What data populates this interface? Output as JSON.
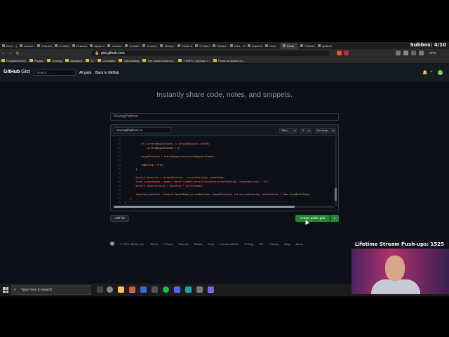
{
  "stream": {
    "subs_label": "Subbos: 4/10",
    "cam_title": "Lifetime Stream Push-ups: 1525"
  },
  "browser": {
    "tabs": [
      {
        "label": "Move - y"
      },
      {
        "label": "Launch H"
      },
      {
        "label": "Characte"
      },
      {
        "label": "Youtube"
      },
      {
        "label": "Finished"
      },
      {
        "label": "Space G"
      },
      {
        "label": "Youtube"
      },
      {
        "label": "Youtube"
      },
      {
        "label": "Youtube"
      },
      {
        "label": "Tomary C"
      },
      {
        "label": "Prinoh A"
      },
      {
        "label": "I'll How t"
      },
      {
        "label": "Surface C"
      },
      {
        "label": "Dani - Yo"
      },
      {
        "label": "Superbut"
      },
      {
        "label": "Store"
      },
      {
        "label": "Creat",
        "active": true
      },
      {
        "label": "Portfolio"
      },
      {
        "label": "spatiotii"
      }
    ],
    "url": "gist.github.com",
    "vpn_label": "VPN",
    "bookmarks": [
      {
        "label": "Programmering"
      },
      {
        "label": "Physics"
      },
      {
        "label": "Gaming"
      },
      {
        "label": "Blackjack"
      },
      {
        "label": "TV"
      },
      {
        "label": "Unrealfilm"
      },
      {
        "label": "Videoediting"
      },
      {
        "label": "The install content s..."
      },
      {
        "label": "YTMP3 | YouTube t..."
      },
      {
        "label": "Phind: AI search en..."
      }
    ]
  },
  "github": {
    "logo": "GitHub",
    "logo_suffix": "Gist",
    "search_placeholder": "Search...",
    "nav": {
      "all_gists": "All gists",
      "back": "Back to GitHub"
    },
    "tagline": "Instantly share code, notes, and snippets.",
    "description_value": "MovingPlatform",
    "filename_value": "MovingPlatform.cs",
    "indent_mode": "Tabs",
    "indent_size": "2",
    "wrap_mode": "No wrap",
    "code_lines": [
      {
        "n": "38",
        "t": ""
      },
      {
        "n": "39",
        "t": "            if (currentWaypointIndex >= actualWaypoints.Length)"
      },
      {
        "n": "40",
        "t": "                currentWaypointIndex = 0;"
      },
      {
        "n": "41",
        "t": ""
      },
      {
        "n": "42",
        "t": "            targetPosition = actualWaypoints[currentWaypointIndex];"
      },
      {
        "n": "43",
        "t": ""
      },
      {
        "n": "44",
        "t": "            isWaiting = true;"
      },
      {
        "n": "45",
        "t": "        }"
      },
      {
        "n": "46",
        "t": ""
      },
      {
        "n": "47",
        "t": "        Vector3 direction = (targetPosition - currentPosition).normalized;"
      },
      {
        "n": "48",
        "t": "        float currentSpeed = speed * Mathf.Clamp01(Vector3.Distance(currentPosition, targetPosition) / 1f);"
      },
      {
        "n": "49",
        "t": "        Vector3 targetVelocity = direction * currentSpeed;"
      },
      {
        "n": "50",
        "t": ""
      },
      {
        "n": "51",
        "t": "        transform.position = Vector3.SmoothDamp(currentPosition, targetPosition, ref currentVelocity, acceleration * Time.fixedDeltaTime);"
      },
      {
        "n": "52",
        "t": "    }"
      },
      {
        "n": "53",
        "t": "}"
      }
    ],
    "add_file": "Add file",
    "create_button": "Create public gist",
    "create_dropdown": "▾",
    "footer": {
      "copyright": "© 2023 GitHub, Inc.",
      "links": [
        "Terms",
        "Privacy",
        "Security",
        "Status",
        "Docs",
        "Contact GitHub",
        "Pricing",
        "API",
        "Training",
        "Blog",
        "About"
      ]
    }
  },
  "taskbar": {
    "search_placeholder": "Type here to search"
  }
}
